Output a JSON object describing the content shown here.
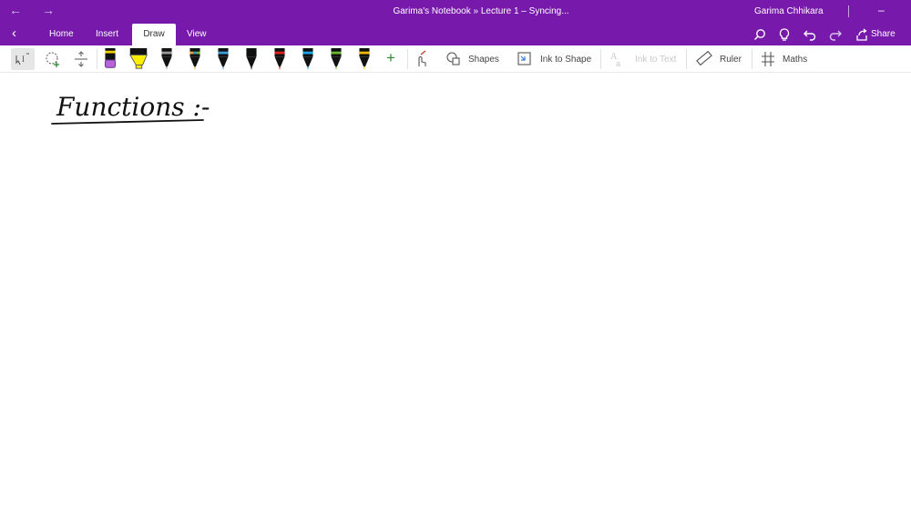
{
  "window": {
    "title": "Garima's Notebook » Lecture 1 – Syncing...",
    "user": "Garima Chhikara",
    "back_arrow": "←",
    "forward_arrow": "→",
    "minimize": "–"
  },
  "ribbon": {
    "back_chevron": "‹",
    "tabs": [
      {
        "label": "Home"
      },
      {
        "label": "Insert"
      },
      {
        "label": "Draw"
      },
      {
        "label": "View"
      }
    ],
    "share_label": "Share"
  },
  "toolbar": {
    "shapes_label": "Shapes",
    "ink_to_shape_label": "Ink to Shape",
    "ink_to_text_label": "Ink to Text",
    "ruler_label": "Ruler",
    "maths_label": "Maths",
    "add_pen_symbol": "+",
    "pens": [
      {
        "color": "#b565d8",
        "kind": "highlighter"
      },
      {
        "color": "#ffee00",
        "kind": "highlighter"
      },
      {
        "color": "#9a9a9a",
        "kind": "pen"
      },
      {
        "color": "#e8a23c",
        "kind": "pen"
      },
      {
        "color": "#3a9bd9",
        "kind": "pen"
      },
      {
        "color": "#111111",
        "kind": "pen"
      },
      {
        "color": "#e02020",
        "kind": "pen"
      },
      {
        "color": "#1aa3e8",
        "kind": "pen"
      },
      {
        "color": "#6ab82e",
        "kind": "pen"
      },
      {
        "color": "#f5b800",
        "kind": "pen"
      }
    ]
  },
  "page": {
    "ink_text": "Functions :-"
  },
  "colors": {
    "accent": "#7719aa",
    "ink": "#111111"
  }
}
